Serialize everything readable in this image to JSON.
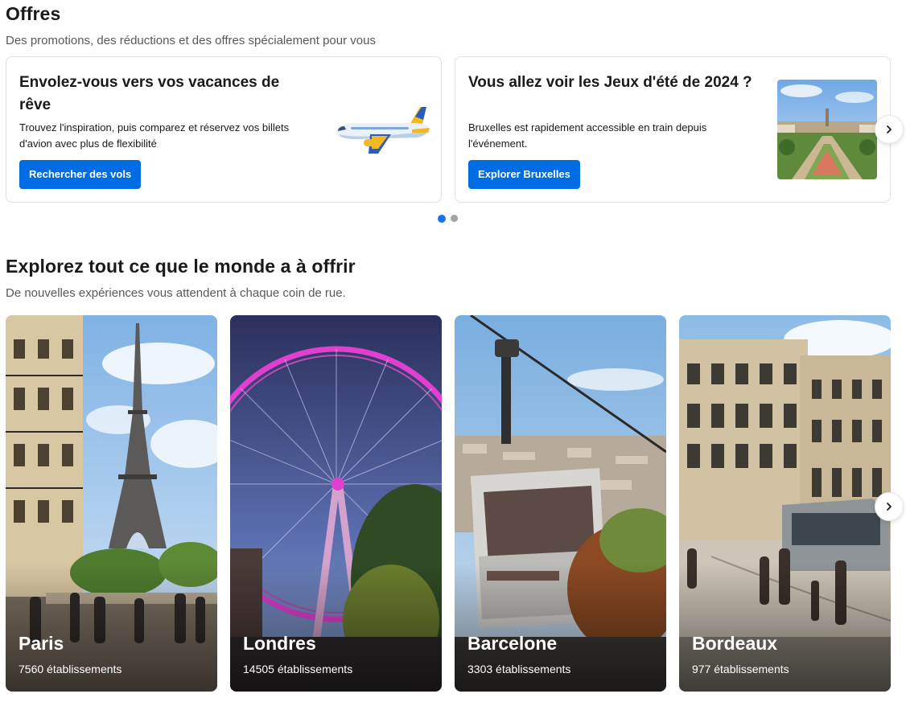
{
  "offers": {
    "title": "Offres",
    "subtitle": "Des promotions, des réductions et des offres spécialement pour vous",
    "cards": [
      {
        "title": "Envolez-vous vers vos vacances de rêve",
        "description": "Trouvez l'inspiration, puis comparez et réservez vos billets d'avion avec plus de flexibilité",
        "button": "Rechercher des vols",
        "image": "airplane-illustration"
      },
      {
        "title": "Vous allez voir les Jeux d'été de 2024 ?",
        "description": "Bruxelles est rapidement accessible en train depuis l'événement.",
        "button": "Explorer Bruxelles",
        "image": "brussels-mont-des-arts-photo"
      }
    ],
    "carousel": {
      "pages": 2,
      "active_page": 1
    }
  },
  "explore": {
    "title": "Explorez tout ce que le monde a à offrir",
    "subtitle": "De nouvelles expériences vous attendent à chaque coin de rue.",
    "destinations": [
      {
        "name": "Paris",
        "count": "7560 établissements",
        "image": "eiffel-tower-photo"
      },
      {
        "name": "Londres",
        "count": "14505 établissements",
        "image": "london-eye-photo"
      },
      {
        "name": "Barcelone",
        "count": "3303 établissements",
        "image": "cable-car-photo"
      },
      {
        "name": "Bordeaux",
        "count": "977 établissements",
        "image": "tram-street-photo"
      }
    ]
  },
  "icons": {
    "next": "chevron-right-icon"
  },
  "colors": {
    "primary_button": "#006ce4",
    "active_dot": "#1a73e8",
    "inactive_dot": "#a3a3a3"
  }
}
